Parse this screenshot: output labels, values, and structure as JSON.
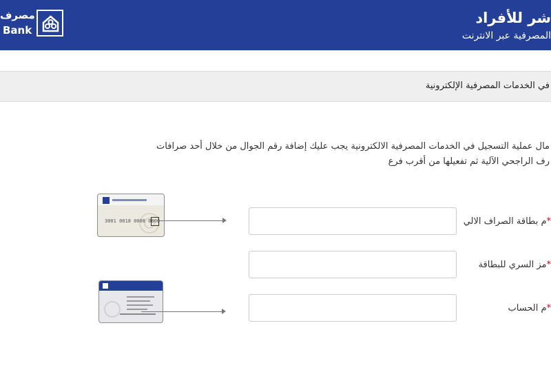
{
  "header": {
    "logo_ar": "مصرف",
    "logo_en": "Bank",
    "title": "شر للأفراد",
    "subtitle": "المصرفية عبر الانترنت"
  },
  "banner": {
    "text": "في الخدمات المصرفية الإلكترونية"
  },
  "instructions": {
    "line1": "مال عملية التسجيل في الخدمات المصرفية الالكترونية يجب عليك إضافة رقم الجوال من خلال أحد صرافات",
    "line2": "رف الراجحي الآلية ثم تفعيلها من أقرب فرع"
  },
  "form": {
    "fields": [
      {
        "label": "م بطاقة الصراف الالي",
        "value": "",
        "placeholder": ""
      },
      {
        "label": "مز السري للبطاقة",
        "value": "",
        "placeholder": ""
      },
      {
        "label": "م الحساب",
        "value": "",
        "placeholder": ""
      }
    ],
    "required_mark": "*"
  },
  "cards": {
    "atm_card_number_groups": [
      "0000",
      "0008",
      "0018",
      "3001"
    ]
  },
  "colors": {
    "header_bg": "#243f97",
    "required": "#d0021b"
  }
}
